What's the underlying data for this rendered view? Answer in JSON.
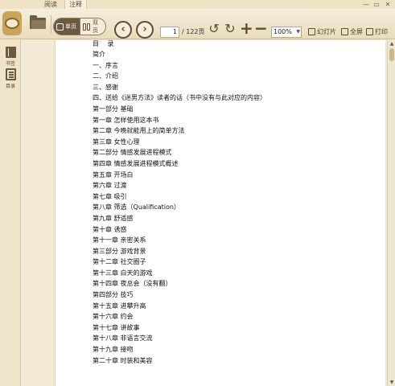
{
  "tabs": [
    {
      "label": "阅读"
    },
    {
      "label": "注释"
    }
  ],
  "window_controls": {
    "minimize": "—",
    "maximize": "▭",
    "close": "✕"
  },
  "toolbar": {
    "single_page_label": "单页",
    "double_page_label": "双页",
    "prev_icon": "‹",
    "next_icon": "›",
    "page_current": "1",
    "page_total": "/ 122页",
    "rotate_left_icon": "↺",
    "rotate_right_icon": "↻",
    "zoom_in_icon": "+",
    "zoom_out_icon": "−",
    "zoom_level": "100%",
    "slideshow_label": "幻灯片",
    "fullscreen_label": "全屏",
    "print_label": "打印"
  },
  "sidebar": {
    "items": [
      {
        "label": "书签",
        "icon": "bookmark-icon"
      },
      {
        "label": "目录",
        "icon": "toc-icon"
      }
    ]
  },
  "document": {
    "title": "目 录",
    "entries": [
      "简介",
      "一、序言",
      "二、介绍",
      "三、感谢",
      "四、送给《迷男方法》读者的话（书中没有与此对应的内容）",
      "第一部分 基础",
      "第一章 怎样使用这本书",
      "第二章 今晚就能用上的简单方法",
      "第三章 女性心理",
      "第二部分 情感发展进程模式",
      "第四章 情感发展进程模式概述",
      "第五章 开场白",
      "第六章 过渡",
      "第七章 吸引",
      "第八章 筛选（Qualification）",
      "第九章 舒适感",
      "第十章 诱惑",
      "第十一章 亲密关系",
      "第三部分 游戏背景",
      "第十二章 社交圈子",
      "第十三章 白天的游戏",
      "第十四章 夜总会（没有翻）",
      "第四部分 技巧",
      "第十五章 进攀升高",
      "第十六章 约会",
      "第十七章 讲故事",
      "第十八章 非语言交流",
      "第十九章 接吻",
      "第二十章 时装和美容"
    ]
  },
  "scrollbar": {
    "up_icon": "▲",
    "down_icon": "▼"
  },
  "colors": {
    "toolbar_bg": "#e9dcbd",
    "accent_dark": "#5d4c34",
    "page_bg": "#ffffff",
    "workspace_bg": "#f3ead6"
  }
}
